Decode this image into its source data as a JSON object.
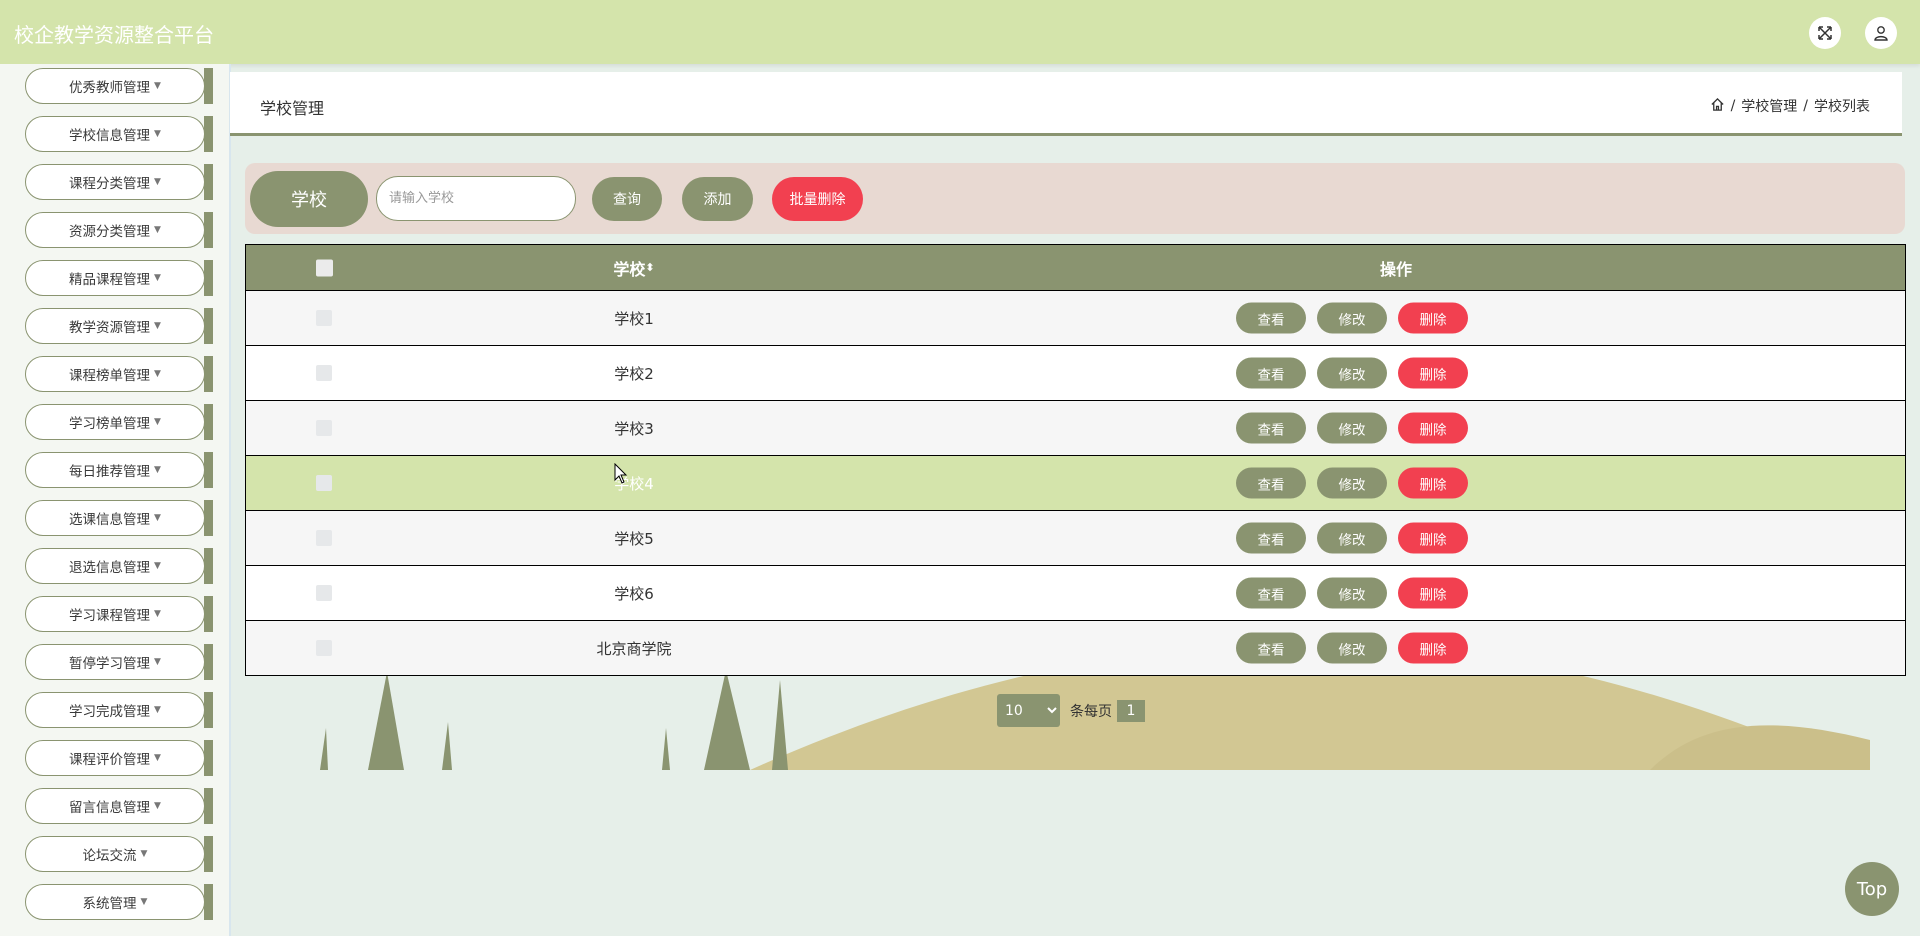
{
  "header": {
    "app_title": "校企教学资源整合平台",
    "icons": [
      "fullscreen-icon",
      "user-icon"
    ]
  },
  "sidebar": {
    "items": [
      {
        "label": "优秀教师管理"
      },
      {
        "label": "学校信息管理"
      },
      {
        "label": "课程分类管理"
      },
      {
        "label": "资源分类管理"
      },
      {
        "label": "精品课程管理"
      },
      {
        "label": "教学资源管理"
      },
      {
        "label": "课程榜单管理"
      },
      {
        "label": "学习榜单管理"
      },
      {
        "label": "每日推荐管理"
      },
      {
        "label": "选课信息管理"
      },
      {
        "label": "退选信息管理"
      },
      {
        "label": "学习课程管理"
      },
      {
        "label": "暂停学习管理"
      },
      {
        "label": "学习完成管理"
      },
      {
        "label": "课程评价管理"
      },
      {
        "label": "留言信息管理"
      },
      {
        "label": "论坛交流"
      },
      {
        "label": "系统管理"
      }
    ]
  },
  "page": {
    "title": "学校管理",
    "breadcrumb": [
      "学校管理",
      "学校列表"
    ],
    "breadcrumb_sep": "/"
  },
  "search": {
    "label": "学校",
    "placeholder": "请输入学校",
    "value": "",
    "query_label": "查询",
    "add_label": "添加",
    "batch_delete_label": "批量删除"
  },
  "table": {
    "headers": {
      "name": "学校",
      "sort_glyph": "⬍",
      "actions": "操作"
    },
    "rows": [
      {
        "name": "学校1"
      },
      {
        "name": "学校2"
      },
      {
        "name": "学校3"
      },
      {
        "name": "学校4"
      },
      {
        "name": "学校5"
      },
      {
        "name": "学校6"
      },
      {
        "name": "北京商学院"
      }
    ],
    "action_labels": {
      "view": "查看",
      "edit": "修改",
      "delete": "删除"
    }
  },
  "pagination": {
    "page_size": "10",
    "page_size_options": [
      "10"
    ],
    "per_page_label": "条每页",
    "current_page": "1"
  },
  "top_button": "Top",
  "colors": {
    "header_bg": "#d4e4ab",
    "accent": "#8a9470",
    "delete": "#f24050",
    "search_bg": "#e8d9d2",
    "hover_row": "#d4e4ab"
  }
}
